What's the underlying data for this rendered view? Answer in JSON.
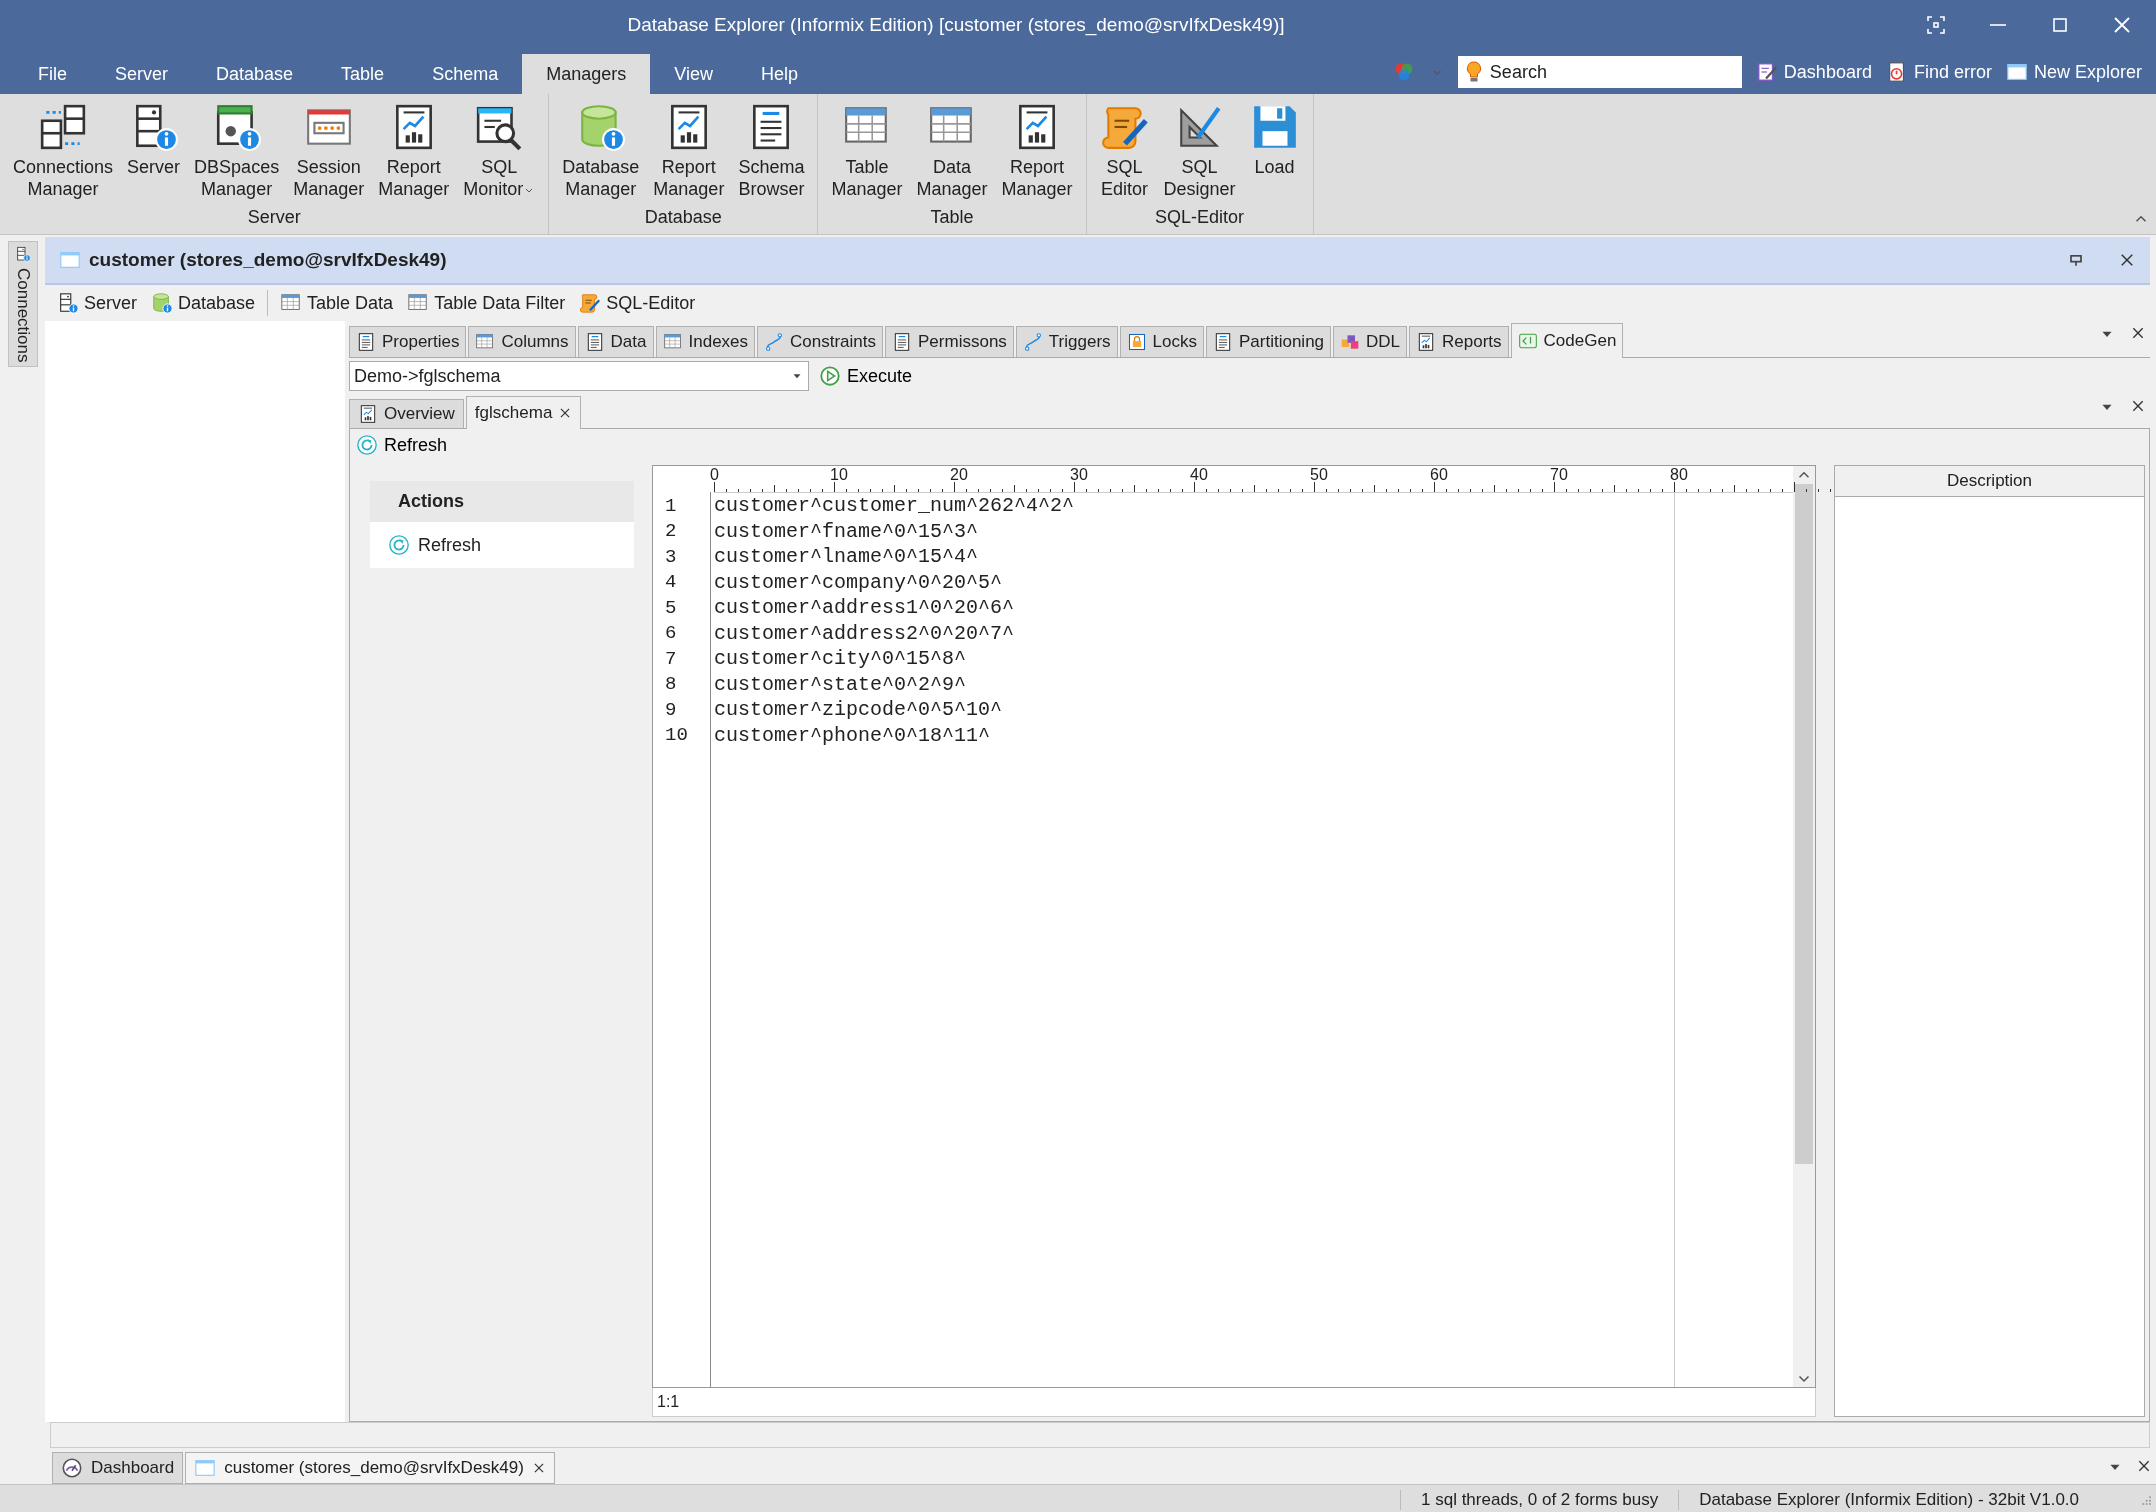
{
  "window": {
    "title": "Database Explorer (Informix Edition) [customer (stores_demo@srvIfxDesk49)]"
  },
  "menu": [
    {
      "label": "File",
      "selected": false
    },
    {
      "label": "Server",
      "selected": false
    },
    {
      "label": "Database",
      "selected": false
    },
    {
      "label": "Table",
      "selected": false
    },
    {
      "label": "Schema",
      "selected": false
    },
    {
      "label": "Managers",
      "selected": true
    },
    {
      "label": "View",
      "selected": false
    },
    {
      "label": "Help",
      "selected": false
    }
  ],
  "quick_access": {
    "search": {
      "placeholder": "Search"
    },
    "links": [
      "Dashboard",
      "Find error",
      "New Explorer"
    ]
  },
  "ribbon": {
    "groups": [
      {
        "label": "Server",
        "buttons": [
          {
            "label": "Connections\nManager",
            "dropdown": false
          },
          {
            "label": "Server",
            "dropdown": false
          },
          {
            "label": "DBSpaces\nManager",
            "dropdown": false
          },
          {
            "label": "Session\nManager",
            "dropdown": false
          },
          {
            "label": "Report\nManager",
            "dropdown": false
          },
          {
            "label": "SQL\nMonitor",
            "dropdown": true
          }
        ]
      },
      {
        "label": "Database",
        "buttons": [
          {
            "label": "Database\nManager",
            "dropdown": false
          },
          {
            "label": "Report\nManager",
            "dropdown": false
          },
          {
            "label": "Schema\nBrowser",
            "dropdown": false
          }
        ]
      },
      {
        "label": "Table",
        "buttons": [
          {
            "label": "Table\nManager",
            "dropdown": false
          },
          {
            "label": "Data\nManager",
            "dropdown": false
          },
          {
            "label": "Report\nManager",
            "dropdown": false
          }
        ]
      },
      {
        "label": "SQL-Editor",
        "buttons": [
          {
            "label": "SQL\nEditor",
            "dropdown": false
          },
          {
            "label": "SQL\nDesigner",
            "dropdown": false
          },
          {
            "label": "Load",
            "dropdown": false
          }
        ]
      }
    ]
  },
  "side_panel": {
    "label": "Connections"
  },
  "document": {
    "title": "customer (stores_demo@srvIfxDesk49)",
    "toolbar": [
      [
        "Server",
        "Database"
      ],
      [
        "Table Data",
        "Table Data Filter",
        "SQL-Editor"
      ]
    ]
  },
  "tabs": [
    {
      "label": "Properties",
      "selected": false
    },
    {
      "label": "Columns",
      "selected": false
    },
    {
      "label": "Data",
      "selected": false
    },
    {
      "label": "Indexes",
      "selected": false
    },
    {
      "label": "Constraints",
      "selected": false
    },
    {
      "label": "Permissons",
      "selected": false
    },
    {
      "label": "Triggers",
      "selected": false
    },
    {
      "label": "Locks",
      "selected": false
    },
    {
      "label": "Partitioning",
      "selected": false
    },
    {
      "label": "DDL",
      "selected": false
    },
    {
      "label": "Reports",
      "selected": false
    },
    {
      "label": "CodeGen",
      "selected": true
    }
  ],
  "query": {
    "value": "Demo->fglschema",
    "action": "Execute"
  },
  "subtabs": [
    {
      "label": "Overview",
      "selected": false,
      "closable": false
    },
    {
      "label": "fglschema",
      "selected": true,
      "closable": true
    }
  ],
  "refresh": "Refresh",
  "actions": {
    "title": "Actions",
    "items": [
      "Refresh"
    ]
  },
  "editor": {
    "ruler": [
      "0",
      "10",
      "20",
      "30",
      "40",
      "50",
      "60",
      "70",
      "80"
    ],
    "lines": [
      {
        "number": "1",
        "text": "customer^customer_num^262^4^2^"
      },
      {
        "number": "2",
        "text": "customer^fname^0^15^3^"
      },
      {
        "number": "3",
        "text": "customer^lname^0^15^4^"
      },
      {
        "number": "4",
        "text": "customer^company^0^20^5^"
      },
      {
        "number": "5",
        "text": "customer^address1^0^20^6^"
      },
      {
        "number": "6",
        "text": "customer^address2^0^20^7^"
      },
      {
        "number": "7",
        "text": "customer^city^0^15^8^"
      },
      {
        "number": "8",
        "text": "customer^state^0^2^9^"
      },
      {
        "number": "9",
        "text": "customer^zipcode^0^5^10^"
      },
      {
        "number": "10",
        "text": "customer^phone^0^18^11^"
      }
    ],
    "position": "1:1"
  },
  "description": {
    "title": "Description"
  },
  "document_tabs": [
    {
      "label": "Dashboard",
      "selected": false,
      "closable": false
    },
    {
      "label": "customer (stores_demo@srvIfxDesk49)",
      "selected": true,
      "closable": true
    }
  ],
  "status_bar": [
    "1 sql threads, 0 of 2 forms busy",
    "Database Explorer (Informix Edition) - 32bit V1.0.0"
  ]
}
